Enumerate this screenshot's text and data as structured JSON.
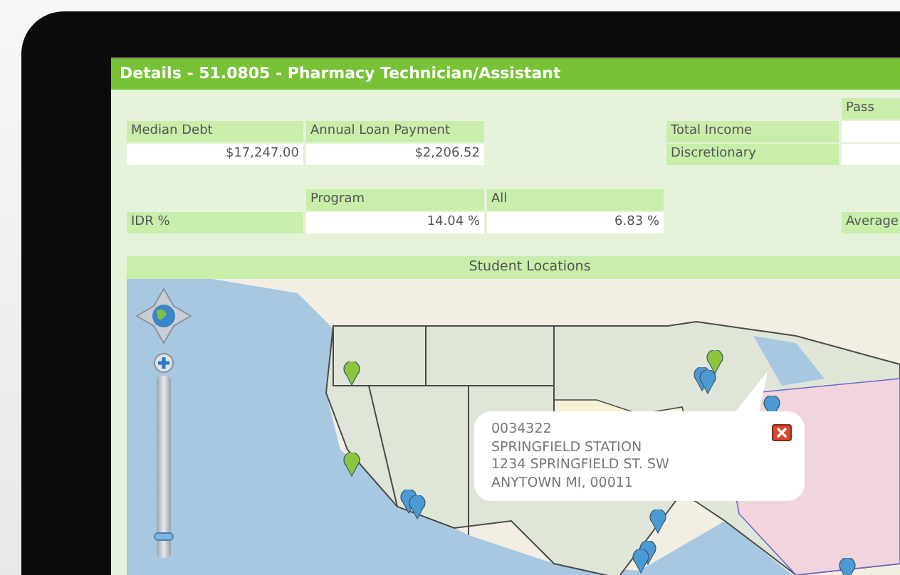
{
  "window": {
    "title": "Details - 51.0805 - Pharmacy Technician/Assistant"
  },
  "debt_table": {
    "headers": [
      "Median Debt",
      "Annual Loan Payment"
    ],
    "values": [
      "$17,247.00",
      "$2,206.52"
    ]
  },
  "income_table": {
    "column_header": "Pass",
    "row_labels": [
      "Total Income",
      "Discretionary"
    ]
  },
  "idr_table": {
    "row_label": "IDR %",
    "headers": [
      "Program",
      "All"
    ],
    "values": [
      "14.04 %",
      "6.83 %"
    ]
  },
  "average_label": "Average",
  "map": {
    "title": "Student Locations",
    "zoom_slider": {
      "level": 0.12
    },
    "popup": {
      "lines": [
        "0034322",
        "SPRINGFIELD STATION",
        "1234 SPRINGFIELD ST. SW",
        "ANYTOWN MI, 00011"
      ]
    }
  }
}
